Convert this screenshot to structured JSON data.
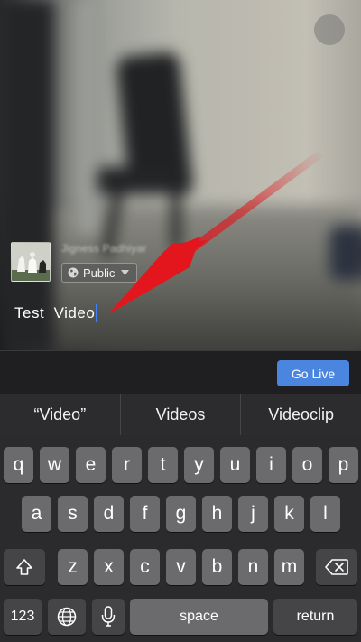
{
  "preview": {
    "username": "Jigness Padhiyar",
    "privacy_label": "Public",
    "caption_text": "Test  Video"
  },
  "toolbar": {
    "go_live_label": "Go Live"
  },
  "predictions": [
    "“Video”",
    "Videos",
    "Videoclip"
  ],
  "keyboard": {
    "row1": [
      "q",
      "w",
      "e",
      "r",
      "t",
      "y",
      "u",
      "i",
      "o",
      "p"
    ],
    "row2": [
      "a",
      "s",
      "d",
      "f",
      "g",
      "h",
      "j",
      "k",
      "l"
    ],
    "row3": [
      "z",
      "x",
      "c",
      "v",
      "b",
      "n",
      "m"
    ],
    "numbers_label": "123",
    "space_label": "space",
    "return_label": "return",
    "icons": {
      "shift": "shift-icon",
      "delete": "backspace-icon",
      "globe": "globe-icon",
      "mic": "microphone-icon"
    }
  },
  "colors": {
    "accent": "#4a86e0",
    "annotation_arrow": "#e3161d",
    "key": "#6b6b6e",
    "fn_key": "#454548"
  }
}
